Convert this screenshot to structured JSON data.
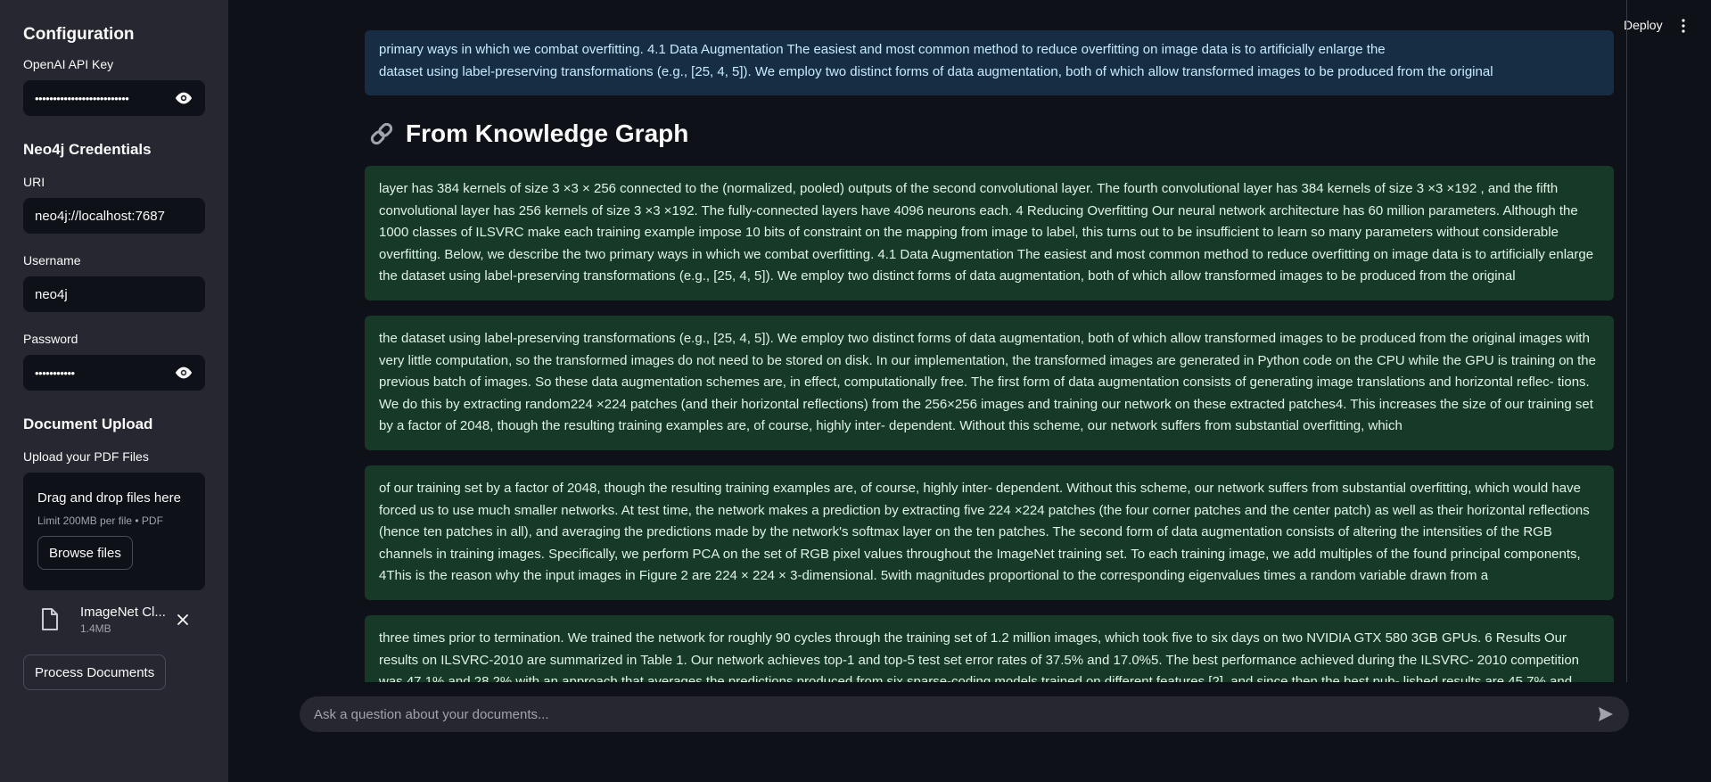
{
  "sidebar": {
    "config_heading": "Configuration",
    "api_key_label": "OpenAI API Key",
    "api_key_value": "••••••••••••••••••••••••••",
    "neo4j_heading": "Neo4j Credentials",
    "uri_label": "URI",
    "uri_value": "neo4j://localhost:7687",
    "username_label": "Username",
    "username_value": "neo4j",
    "password_label": "Password",
    "password_value": "•••••••••••",
    "upload_heading": "Document Upload",
    "upload_label": "Upload your PDF Files",
    "dropzone_title": "Drag and drop files here",
    "dropzone_limit": "Limit 200MB per file • PDF",
    "browse_label": "Browse files",
    "file": {
      "name": "ImageNet Cl...",
      "size": "1.4MB"
    },
    "process_label": "Process Documents"
  },
  "header": {
    "deploy_label": "Deploy"
  },
  "main": {
    "top_box_line1": "primary ways in which we combat overfitting. 4.1 Data Augmentation The easiest and most common method to reduce overfitting on image data is to artificially enlarge the",
    "top_box_line2": "dataset using label-preserving transformations (e.g., [25, 4, 5]). We employ two distinct forms of data augmentation, both of which allow transformed images to be produced from the original",
    "section_heading": "From Knowledge Graph",
    "results": [
      "layer has 384 kernels of size 3 ×3 × 256 connected to the (normalized, pooled) outputs of the second convolutional layer. The fourth convolutional layer has 384 kernels of size 3 ×3 ×192 , and the fifth convolutional layer has 256 kernels of size 3 ×3 ×192. The fully-connected layers have 4096 neurons each. 4 Reducing Overfitting Our neural network architecture has 60 million parameters. Although the 1000 classes of ILSVRC make each training example impose 10 bits of constraint on the mapping from image to label, this turns out to be insufficient to learn so many parameters without considerable overfitting. Below, we describe the two primary ways in which we combat overfitting. 4.1 Data Augmentation The easiest and most common method to reduce overfitting on image data is to artificially enlarge the dataset using label-preserving transformations (e.g., [25, 4, 5]). We employ two distinct forms of data augmentation, both of which allow transformed images to be produced from the original",
      "the dataset using label-preserving transformations (e.g., [25, 4, 5]). We employ two distinct forms of data augmentation, both of which allow transformed images to be produced from the original images with very little computation, so the transformed images do not need to be stored on disk. In our implementation, the transformed images are generated in Python code on the CPU while the GPU is training on the previous batch of images. So these data augmentation schemes are, in effect, computationally free. The first form of data augmentation consists of generating image translations and horizontal reflec- tions. We do this by extracting random224 ×224 patches (and their horizontal reflections) from the 256×256 images and training our network on these extracted patches4. This increases the size of our training set by a factor of 2048, though the resulting training examples are, of course, highly inter- dependent. Without this scheme, our network suffers from substantial overfitting, which",
      "of our training set by a factor of 2048, though the resulting training examples are, of course, highly inter- dependent. Without this scheme, our network suffers from substantial overfitting, which would have forced us to use much smaller networks. At test time, the network makes a prediction by extracting five 224 ×224 patches (the four corner patches and the center patch) as well as their horizontal reflections (hence ten patches in all), and averaging the predictions made by the network's softmax layer on the ten patches. The second form of data augmentation consists of altering the intensities of the RGB channels in training images. Specifically, we perform PCA on the set of RGB pixel values throughout the ImageNet training set. To each training image, we add multiples of the found principal components, 4This is the reason why the input images in Figure 2 are 224 × 224 × 3-dimensional. 5with magnitudes proportional to the corresponding eigenvalues times a random variable drawn from a",
      "three times prior to termination. We trained the network for roughly 90 cycles through the training set of 1.2 million images, which took five to six days on two NVIDIA GTX 580 3GB GPUs. 6 Results Our results on ILSVRC-2010 are summarized in Table 1. Our network achieves top-1 and top-5 test set error rates of 37.5% and 17.0%5. The best performance achieved during the ILSVRC- 2010 competition was 47.1% and 28.2% with an approach that averages the predictions produced from six sparse-coding models trained on different features [2], and since then the best pub- lished results are 45.7% and 25.7% with an"
    ]
  },
  "chat": {
    "placeholder": "Ask a question about your documents..."
  },
  "colors": {
    "background": "#0e1117",
    "sidebar": "#262730",
    "info_box": "#172d43",
    "success_box": "#173928"
  },
  "icons": [
    "eye-icon",
    "file-icon",
    "close-icon",
    "kebab-menu-icon",
    "link-icon",
    "send-icon"
  ]
}
